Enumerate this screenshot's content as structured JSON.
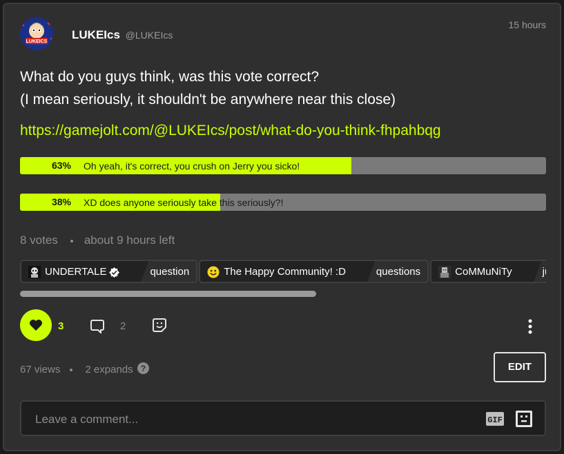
{
  "post": {
    "author_name": "LUKEIcs",
    "author_handle": "@LUKEIcs",
    "timestamp": "15 hours",
    "avatar_text": "LUKEICS",
    "text_line1": "What do you guys think, was this vote correct?",
    "text_line2": "(I mean seriously, it shouldn't be anywhere near this close)",
    "link": "https://gamejolt.com/@LUKEIcs/post/what-do-you-think-fhpahbqg"
  },
  "poll": {
    "options": [
      {
        "percent_label": "63%",
        "percent": 63,
        "label": "Oh yeah, it's correct, you crush on Jerry you sicko!"
      },
      {
        "percent_label": "38%",
        "percent": 38,
        "label": "XD does anyone seriously take this seriously?!"
      }
    ],
    "votes": "8 votes",
    "time_left": "about 9 hours left"
  },
  "tags": [
    {
      "community": "UNDERTALE",
      "channel": "question",
      "verified": true,
      "icon": "undertale-icon"
    },
    {
      "community": "The Happy Community! :D",
      "channel": "questions",
      "verified": false,
      "icon": "smiley-icon"
    },
    {
      "community": "CoMMuNiTy",
      "channel": "ju",
      "verified": false,
      "icon": "community-icon"
    }
  ],
  "actions": {
    "like_count": "3",
    "comment_count": "2"
  },
  "stats": {
    "views": "67 views",
    "expands": "2 expands"
  },
  "edit_label": "EDIT",
  "comment": {
    "placeholder": "Leave a comment..."
  },
  "colors": {
    "accent": "#ccff00",
    "card_bg": "#2f2f2f",
    "poll_bg": "#7a7a7a",
    "muted_text": "#8c8c8c"
  }
}
